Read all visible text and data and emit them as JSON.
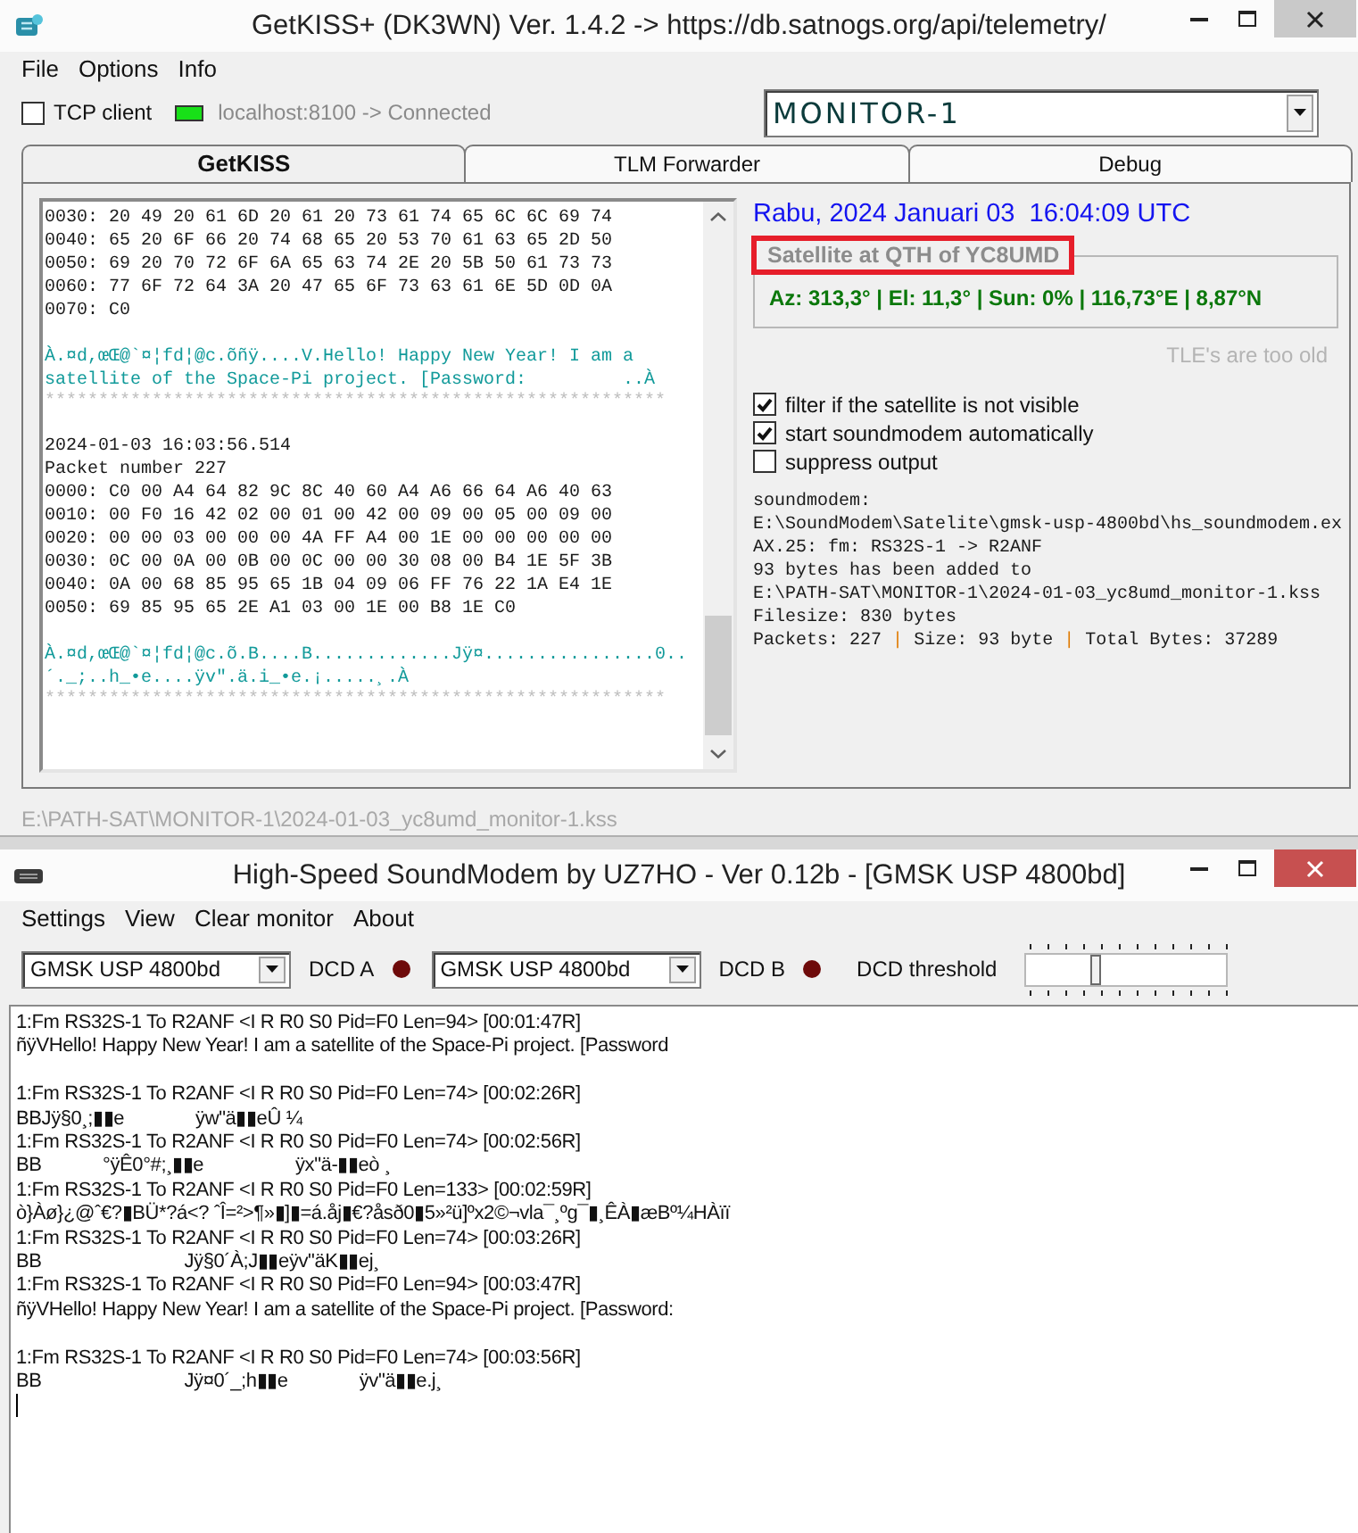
{
  "getkiss": {
    "window": {
      "title": "GetKISS+ (DK3WN) Ver. 1.4.2 -> https://db.satnogs.org/api/telemetry/",
      "active": false
    },
    "menu": [
      "File",
      "Options",
      "Info"
    ],
    "tcp_client": {
      "label": "TCP client",
      "checked": false
    },
    "connection": {
      "text": "localhost:8100 -> Connected",
      "connected": true
    },
    "station": {
      "value": "MONITOR-1"
    },
    "tabs": [
      {
        "label": "GetKISS",
        "selected": true
      },
      {
        "label": "TLM Forwarder",
        "selected": false
      },
      {
        "label": "Debug",
        "selected": false
      }
    ],
    "log": {
      "lines": [
        {
          "kind": "plain",
          "text": "0030: 20 49 20 61 6D 20 61 20 73 61 74 65 6C 6C 69 74"
        },
        {
          "kind": "plain",
          "text": "0040: 65 20 6F 66 20 74 68 65 20 53 70 61 63 65 2D 50"
        },
        {
          "kind": "plain",
          "text": "0050: 69 20 70 72 6F 6A 65 63 74 2E 20 5B 50 61 73 73"
        },
        {
          "kind": "plain",
          "text": "0060: 77 6F 72 64 3A 20 47 65 6F 73 63 61 6E 5D 0D 0A"
        },
        {
          "kind": "plain",
          "text": "0070: C0"
        },
        {
          "kind": "blank"
        },
        {
          "kind": "decoded",
          "text": "À.¤d,œŒ@`¤¦fd¦@c.õñÿ....V.Hello! Happy New Year! I am a"
        },
        {
          "kind": "decoded",
          "text": "satellite of the Space-Pi project. [Password:         ..À"
        },
        {
          "kind": "rule",
          "text": "**********************************************************"
        },
        {
          "kind": "blank"
        },
        {
          "kind": "plain",
          "text": "2024-01-03 16:03:56.514"
        },
        {
          "kind": "plain",
          "text": "Packet number 227"
        },
        {
          "kind": "plain",
          "text": "0000: C0 00 A4 64 82 9C 8C 40 60 A4 A6 66 64 A6 40 63"
        },
        {
          "kind": "plain",
          "text": "0010: 00 F0 16 42 02 00 01 00 42 00 09 00 05 00 09 00"
        },
        {
          "kind": "plain",
          "text": "0020: 00 00 03 00 00 00 4A FF A4 00 1E 00 00 00 00 00"
        },
        {
          "kind": "plain",
          "text": "0030: 0C 00 0A 00 0B 00 0C 00 00 30 08 00 B4 1E 5F 3B"
        },
        {
          "kind": "plain",
          "text": "0040: 0A 00 68 85 95 65 1B 04 09 06 FF 76 22 1A E4 1E"
        },
        {
          "kind": "plain",
          "text": "0050: 69 85 95 65 2E A1 03 00 1E 00 B8 1E C0"
        },
        {
          "kind": "blank"
        },
        {
          "kind": "decoded",
          "text": "À.¤d,œŒ@`¤¦fd¦@c.õ.B....B.............Jÿ¤................0.."
        },
        {
          "kind": "decoded",
          "text": "´._;..h_•e....ÿv\".ä.i_•e.¡.....¸.À"
        },
        {
          "kind": "rule",
          "text": "**********************************************************"
        }
      ]
    },
    "datetime": "Rabu, 2024 Januari 03  16:04:09 UTC",
    "satellite": {
      "title": "Satellite at QTH of YC8UMD",
      "highlighted": true,
      "position": "Az: 313,3° | El: 11,3° | Sun: 0% | 116,73°E | 8,87°N"
    },
    "tle_status": "TLE's are too old",
    "options": [
      {
        "label": "filter if the satellite is not visible",
        "checked": true
      },
      {
        "label": "start soundmodem automatically",
        "checked": true
      },
      {
        "label": "suppress output",
        "checked": false
      }
    ],
    "info_lines": [
      "soundmodem:",
      "E:\\SoundModem\\Satelite\\gmsk-usp-4800bd\\hs_soundmodem.ex",
      "AX.25: fm: RS32S-1 -> R2ANF",
      "93 bytes has been added to",
      "E:\\PATH-SAT\\MONITOR-1\\2024-01-03_yc8umd_monitor-1.kss",
      "Filesize: 830 bytes"
    ],
    "stats": {
      "items": [
        "Packets: 227",
        "Size: 93 byte",
        "Total Bytes: 37289"
      ],
      "separator": "|"
    },
    "file_path": "E:\\PATH-SAT\\MONITOR-1\\2024-01-03_yc8umd_monitor-1.kss"
  },
  "soundmodem": {
    "window": {
      "title": "High-Speed SoundModem by UZ7HO - Ver 0.12b - [GMSK USP 4800bd]",
      "active": true
    },
    "menu": [
      "Settings",
      "View",
      "Clear monitor",
      "About"
    ],
    "modems": [
      {
        "mode": "GMSK USP 4800bd",
        "dcd_label": "DCD A",
        "dcd_on": false
      },
      {
        "mode": "GMSK USP 4800bd",
        "dcd_label": "DCD B",
        "dcd_on": false
      }
    ],
    "dcd_threshold": {
      "label": "DCD threshold",
      "level": 0.34
    },
    "monitor": {
      "lines": [
        {
          "kind": "text",
          "text": "1:Fm RS32S-1 To R2ANF <I R R0 S0 Pid=F0 Len=94> [00:01:47R]"
        },
        {
          "kind": "text",
          "text": "ñÿVHello! Happy New Year! I am a satellite of the Space-Pi project. [Password"
        },
        {
          "kind": "blank"
        },
        {
          "kind": "text",
          "text": "1:Fm RS32S-1 To R2ANF <I R R0 S0 Pid=F0 Len=74> [00:02:26R]"
        },
        {
          "kind": "text",
          "text": "BBJÿ§0¸;▮▮e              ÿw\"ä▮▮eÛ ¼"
        },
        {
          "kind": "text",
          "text": "1:Fm RS32S-1 To R2ANF <I R R0 S0 Pid=F0 Len=74> [00:02:56R]"
        },
        {
          "kind": "text",
          "text": "BB            °ÿÊ0°#;¸▮▮e                  ÿx\"ä-▮▮eò ¸"
        },
        {
          "kind": "text",
          "text": "1:Fm RS32S-1 To R2ANF <I R R0 S0 Pid=F0 Len=133> [00:02:59R]"
        },
        {
          "kind": "text",
          "text": "ò}Àø}¿@ˆ€?▮BÜ*?á<? ˆÎ=²>¶»▮]▮=á.åj▮€?åsð0▮5»²ü]ºx2©¬vla¯¸ºg¯▮¸ÊÀ▮æBº¼HÀïï"
        },
        {
          "kind": "text",
          "text": "1:Fm RS32S-1 To R2ANF <I R R0 S0 Pid=F0 Len=74> [00:03:26R]"
        },
        {
          "kind": "text",
          "text": "BB                            Jÿ§0´À;J▮▮eÿv\"äK▮▮ej¸"
        },
        {
          "kind": "text",
          "text": "1:Fm RS32S-1 To R2ANF <I R R0 S0 Pid=F0 Len=94> [00:03:47R]"
        },
        {
          "kind": "text",
          "text": "ñÿVHello! Happy New Year! I am a satellite of the Space-Pi project. [Password:"
        },
        {
          "kind": "blank"
        },
        {
          "kind": "text",
          "text": "1:Fm RS32S-1 To R2ANF <I R R0 S0 Pid=F0 Len=74> [00:03:56R]"
        },
        {
          "kind": "text",
          "text": "BB                            Jÿ¤0´_;h▮▮e              ÿv\"ä▮▮e.j¸"
        }
      ]
    }
  }
}
